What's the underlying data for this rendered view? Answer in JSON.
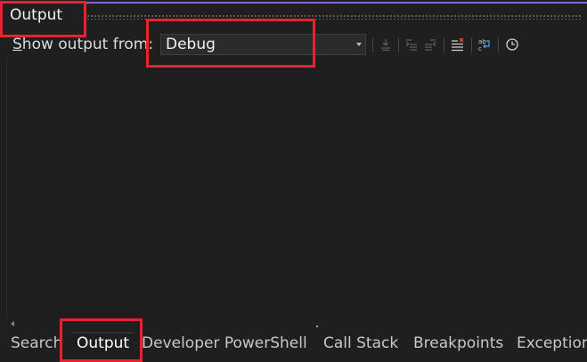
{
  "colors": {
    "accent": "#8a63d2",
    "highlight": "#e8222e"
  },
  "panel": {
    "title": "Output"
  },
  "toolbar": {
    "show_label_prefix": "S",
    "show_label_rest": "how output from:",
    "source_value": "Debug",
    "icons": [
      "find-message-icon",
      "previous-message-icon",
      "next-message-icon",
      "clear-all-icon",
      "word-wrap-icon",
      "timestamp-icon"
    ]
  },
  "tabs": [
    {
      "label": "Search"
    },
    {
      "label": "Output"
    },
    {
      "label": "Developer PowerShell"
    },
    {
      "label": "Call Stack"
    },
    {
      "label": "Breakpoints"
    },
    {
      "label": "Exception"
    }
  ]
}
